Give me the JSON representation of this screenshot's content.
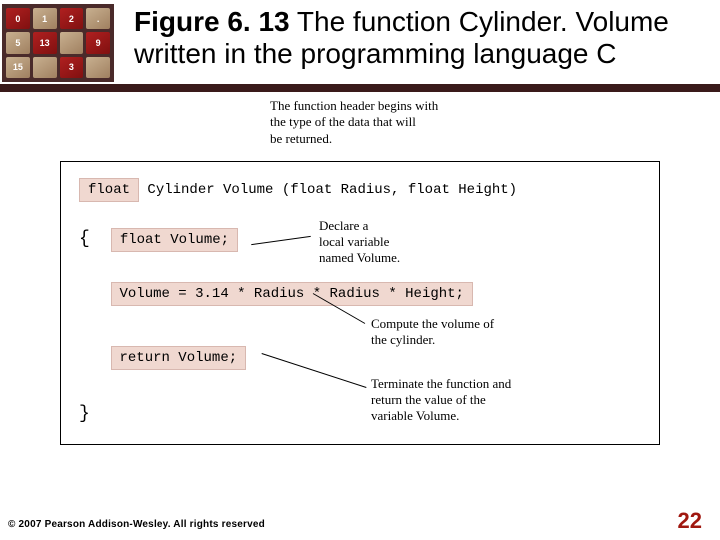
{
  "title": {
    "bold": "Figure 6. 13",
    "rest": "  The function Cylinder. Volume written in the programming language C"
  },
  "badge_cells": [
    "0",
    "1",
    "2",
    ".",
    "5",
    "13",
    "",
    "9",
    "15",
    "",
    "3",
    ""
  ],
  "annot": {
    "top_l1": "The function header begins with",
    "top_l2": "the type of the data that will",
    "top_l3": "be returned.",
    "declare_l1": "Declare a",
    "declare_l2": "local variable",
    "declare_l3": "named Volume.",
    "compute_l1": "Compute the volume of",
    "compute_l2": "the cylinder.",
    "term_l1": "Terminate the function and",
    "term_l2": "return the value of the",
    "term_l3": "variable Volume."
  },
  "code": {
    "float_kw": "float",
    "header_rest": " Cylinder Volume (float Radius, float Height)",
    "open_brace": "{",
    "decl": "float Volume;",
    "assign": "Volume = 3.14 * Radius * Radius * Height;",
    "ret": "return Volume;",
    "close_brace": "}"
  },
  "footer": "© 2007 Pearson Addison-Wesley. All rights reserved",
  "page": "22"
}
